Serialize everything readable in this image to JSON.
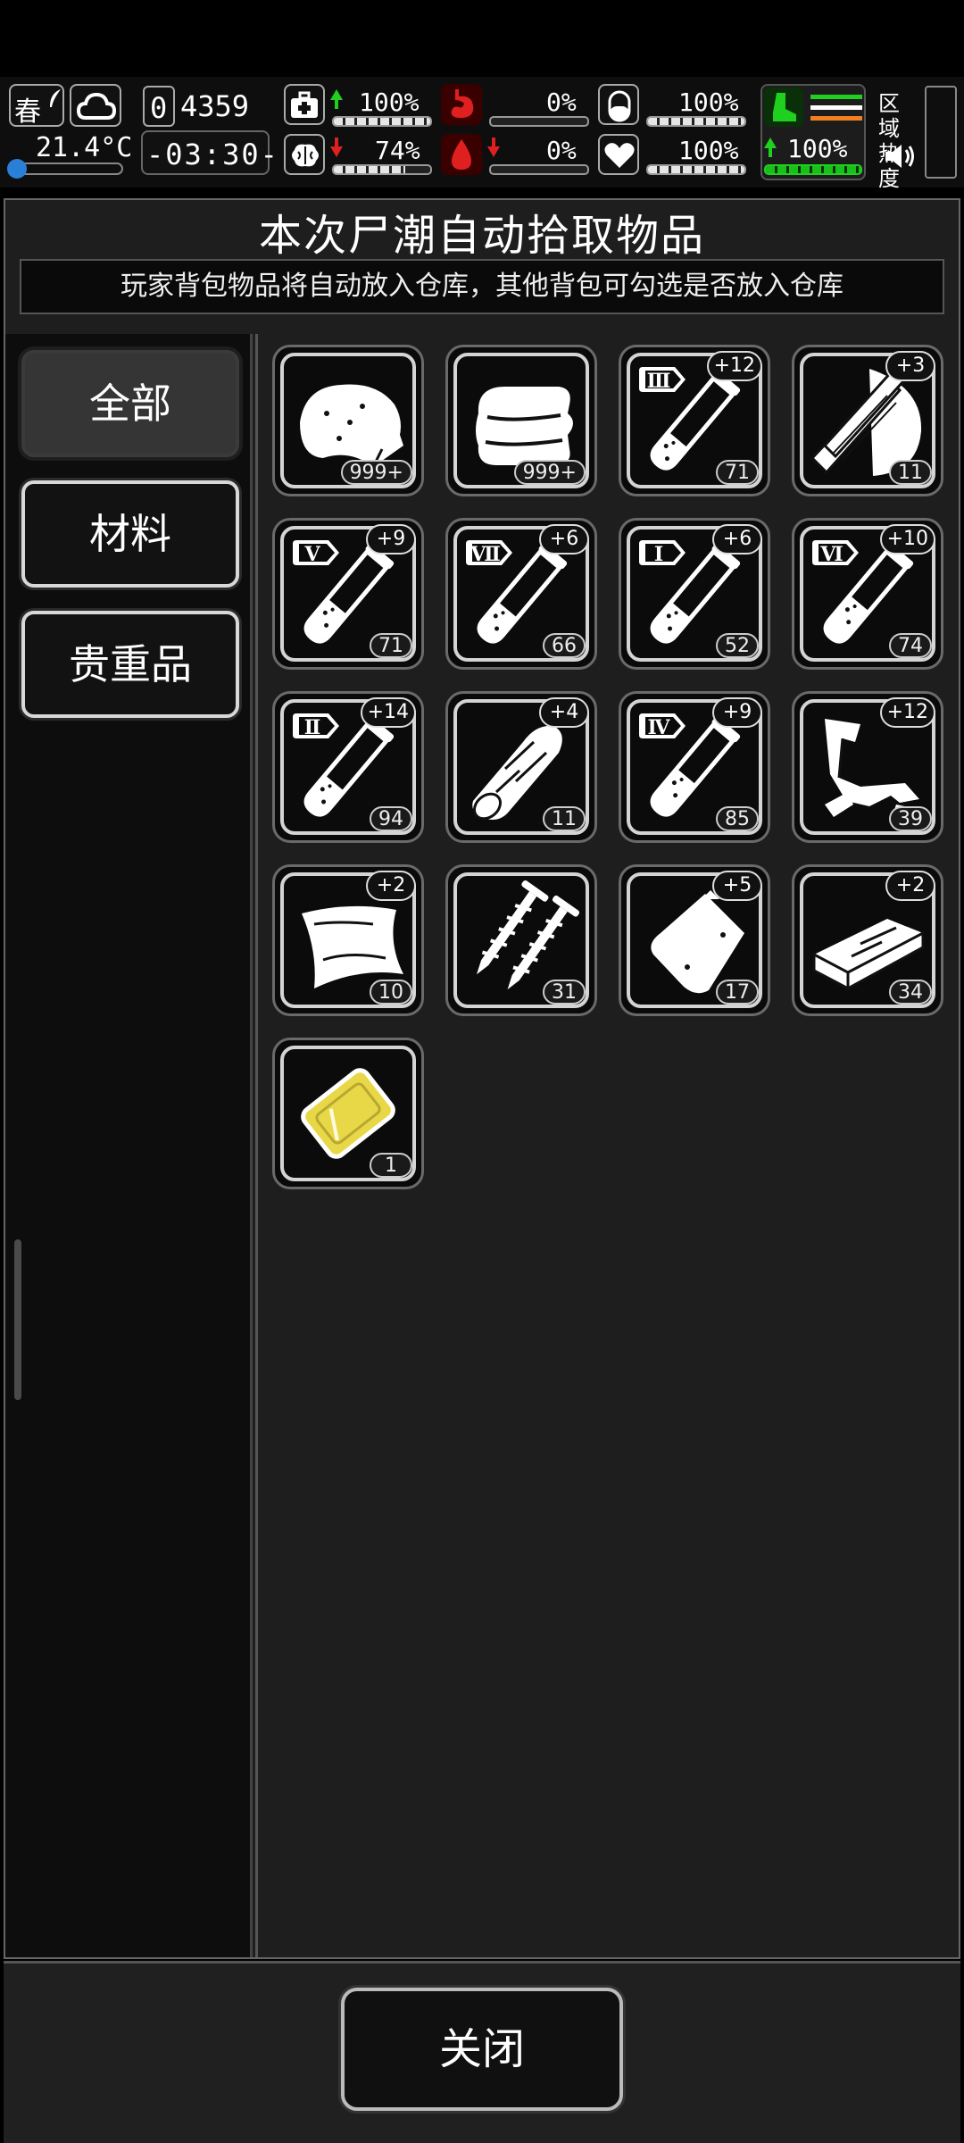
{
  "hud": {
    "season": "春",
    "temperature": "21.4°C",
    "counter": "0",
    "counter_rest": "4359",
    "time": "-03:30-",
    "region_heat_label": "区域热度",
    "stats": {
      "health": "100%",
      "hunger": "0%",
      "pill": "100%",
      "sanity": "74%",
      "blood": "0%",
      "heart": "100%",
      "stamina": "100%"
    },
    "bars": {
      "health": 1.0,
      "hunger": 0.0,
      "pill": 1.0,
      "sanity": 0.74,
      "blood": 0.0,
      "heart": 1.0,
      "stamina": 1.0
    }
  },
  "title": "本次尸潮自动拾取物品",
  "subtitle": "玩家背包物品将自动放入仓库，其他背包可勾选是否放入仓库",
  "categories": [
    "全部",
    "材料",
    "贵重品"
  ],
  "active_category": "全部",
  "items": [
    {
      "icon": "meat-icon",
      "count": "999+",
      "plus": ""
    },
    {
      "icon": "cloth-icon",
      "count": "999+",
      "plus": ""
    },
    {
      "icon": "test-tube-iii-icon",
      "count": "71",
      "plus": "+12",
      "roman": "Ⅲ",
      "level": 0.25
    },
    {
      "icon": "wood-planks-icon",
      "count": "11",
      "plus": "+3"
    },
    {
      "icon": "test-tube-v-icon",
      "count": "71",
      "plus": "+9",
      "roman": "Ⅴ",
      "level": 0.35
    },
    {
      "icon": "test-tube-vii-icon",
      "count": "66",
      "plus": "+6",
      "roman": "Ⅶ",
      "level": 0.3
    },
    {
      "icon": "test-tube-i-icon",
      "count": "52",
      "plus": "+6",
      "roman": "Ⅰ",
      "level": 0.3
    },
    {
      "icon": "test-tube-vi-icon",
      "count": "74",
      "plus": "+10",
      "roman": "Ⅵ",
      "level": 0.4
    },
    {
      "icon": "test-tube-ii-icon",
      "count": "94",
      "plus": "+14",
      "roman": "Ⅱ",
      "level": 0.3
    },
    {
      "icon": "log-icon",
      "count": "11",
      "plus": "+4"
    },
    {
      "icon": "test-tube-iv-icon",
      "count": "85",
      "plus": "+9",
      "roman": "Ⅳ",
      "level": 0.4
    },
    {
      "icon": "scrap-metal-icon",
      "count": "39",
      "plus": "+12"
    },
    {
      "icon": "plastic-sheet-icon",
      "count": "10",
      "plus": "+2"
    },
    {
      "icon": "nails-icon",
      "count": "31",
      "plus": ""
    },
    {
      "icon": "plastic-bag-icon",
      "count": "17",
      "plus": "+5"
    },
    {
      "icon": "brick-icon",
      "count": "34",
      "plus": "+2"
    },
    {
      "icon": "gold-card-icon",
      "count": "1",
      "plus": ""
    }
  ],
  "close_label": "关闭",
  "colors": {
    "gold": "#e8d848",
    "green": "#1fd01f",
    "red": "#e02020"
  }
}
